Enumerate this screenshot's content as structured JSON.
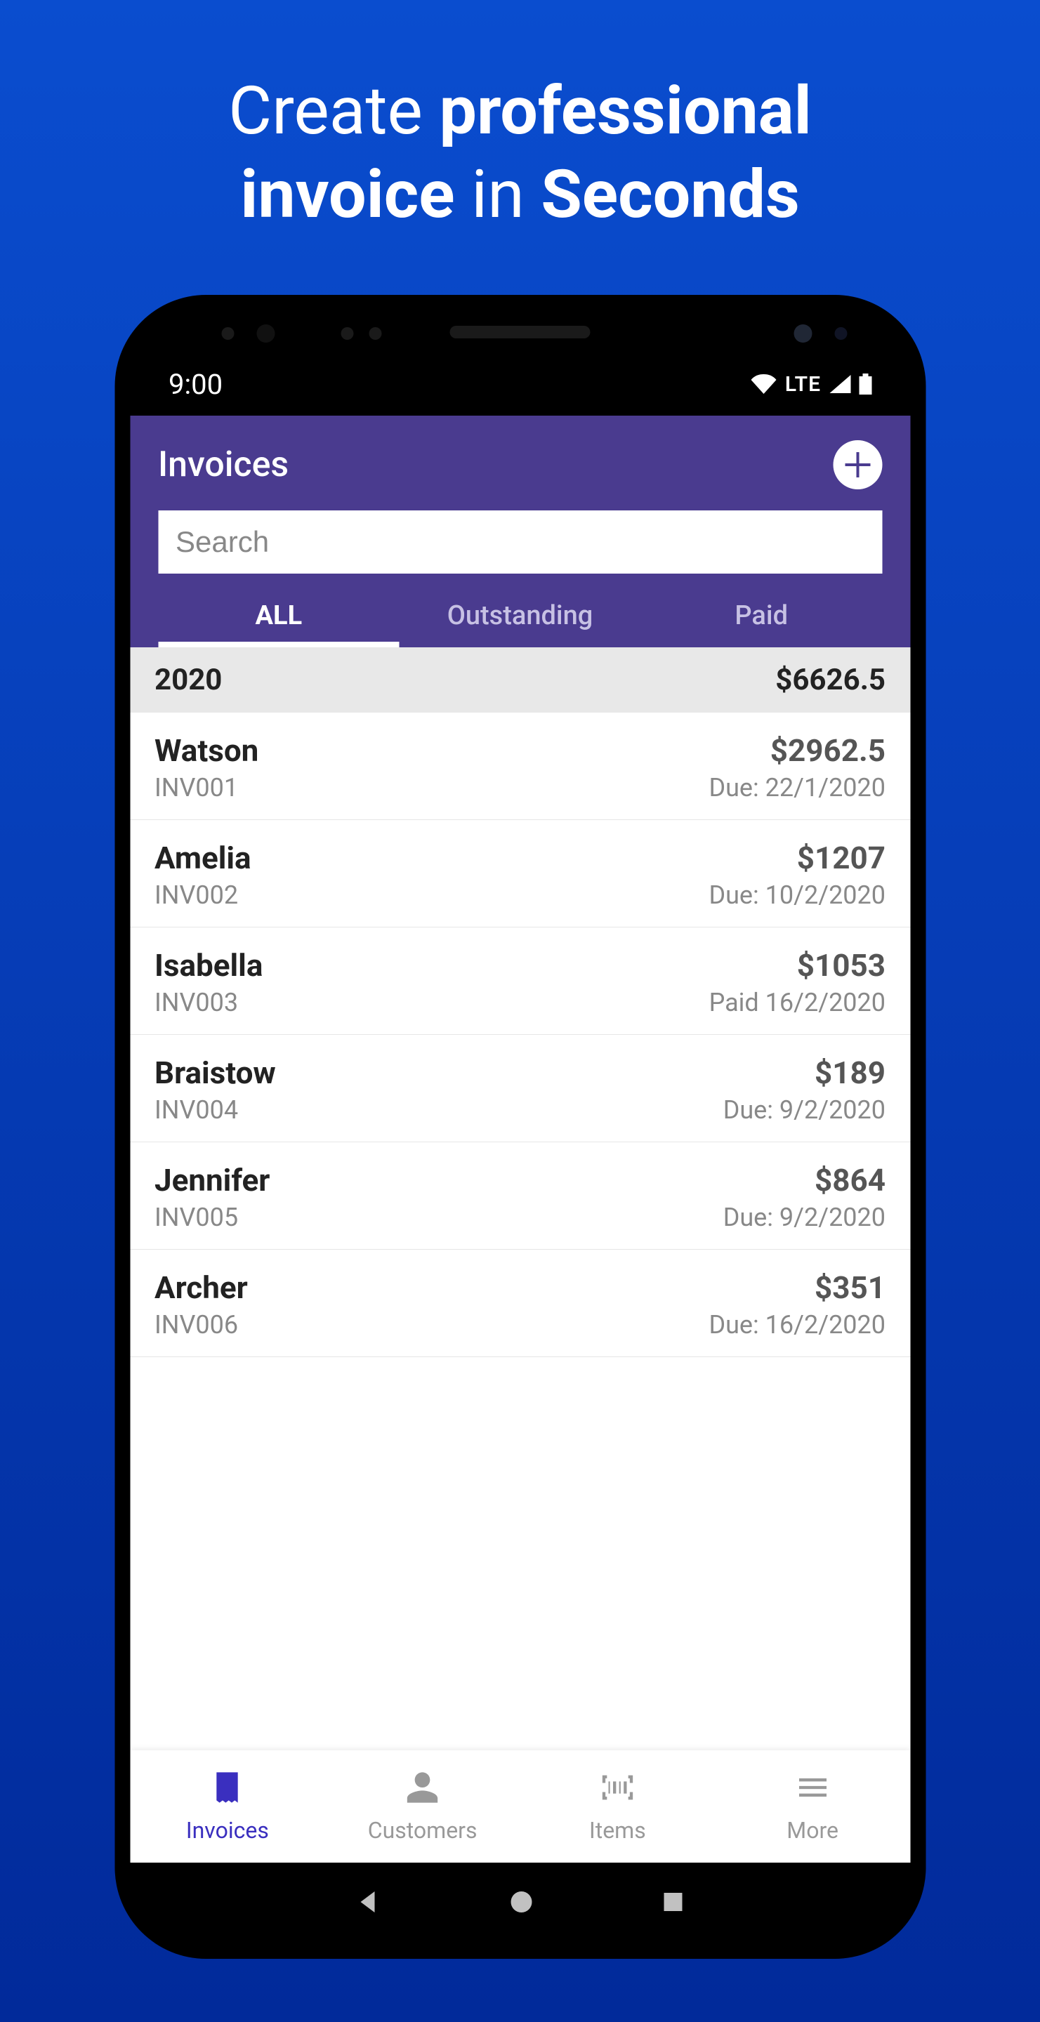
{
  "headline": {
    "pre1": "Create ",
    "bold1": "professional",
    "line2_bold1": "invoice",
    "line2_mid": " in ",
    "line2_bold2": "Seconds"
  },
  "status": {
    "time": "9:00",
    "network": "LTE"
  },
  "app": {
    "title": "Invoices",
    "search_placeholder": "Search"
  },
  "tabs": [
    {
      "label": "ALL",
      "active": true
    },
    {
      "label": "Outstanding",
      "active": false
    },
    {
      "label": "Paid",
      "active": false
    }
  ],
  "summary": {
    "year": "2020",
    "total": "$6626.5"
  },
  "invoices": [
    {
      "name": "Watson",
      "code": "INV001",
      "amount": "$2962.5",
      "status": "Due: 22/1/2020"
    },
    {
      "name": "Amelia",
      "code": "INV002",
      "amount": "$1207",
      "status": "Due: 10/2/2020"
    },
    {
      "name": "Isabella",
      "code": "INV003",
      "amount": "$1053",
      "status": "Paid 16/2/2020"
    },
    {
      "name": "Braistow",
      "code": "INV004",
      "amount": "$189",
      "status": "Due: 9/2/2020"
    },
    {
      "name": "Jennifer",
      "code": "INV005",
      "amount": "$864",
      "status": "Due: 9/2/2020"
    },
    {
      "name": "Archer",
      "code": "INV006",
      "amount": "$351",
      "status": "Due: 16/2/2020"
    }
  ],
  "nav": [
    {
      "label": "Invoices",
      "icon": "receipt",
      "active": true
    },
    {
      "label": "Customers",
      "icon": "person",
      "active": false
    },
    {
      "label": "Items",
      "icon": "barcode",
      "active": false
    },
    {
      "label": "More",
      "icon": "menu",
      "active": false
    }
  ]
}
